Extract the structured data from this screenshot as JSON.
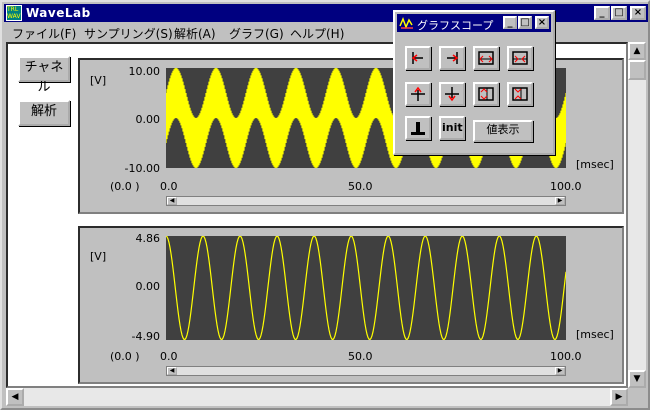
{
  "window": {
    "title": "WaveLab",
    "minimize": "_",
    "maximize": "□",
    "close": "×"
  },
  "menu": [
    {
      "label": "ファイル(F)"
    },
    {
      "label": "サンプリング(S)"
    },
    {
      "label": "解析(A)"
    },
    {
      "label": "グラフ(G)"
    },
    {
      "label": "ヘルプ(H)"
    }
  ],
  "side_buttons": {
    "channel": "チャネル",
    "analyze": "解析"
  },
  "scope_window": {
    "title": "グラフスコープ",
    "value_display": "値表示",
    "init": "init"
  },
  "chart_data": [
    {
      "type": "line",
      "ylabel": "[V]",
      "xlabel": "[msec]",
      "yticks": [
        "10.00",
        "0.00",
        "-10.00"
      ],
      "xticks": [
        "0.0",
        "50.0",
        "100.0"
      ],
      "x_origin_label": "(0.0     )",
      "ylim": [
        -10,
        10
      ],
      "xlim": [
        0,
        100
      ],
      "series": [
        {
          "color": "#ffff00",
          "cycles": 10,
          "amplitude_max": 10,
          "amplitude_min": -10,
          "dense": true
        }
      ]
    },
    {
      "type": "line",
      "ylabel": "[V]",
      "xlabel": "[msec]",
      "yticks": [
        "4.86",
        "0.00",
        "-4.90"
      ],
      "xticks": [
        "0.0",
        "50.0",
        "100.0"
      ],
      "x_origin_label": "(0.0     )",
      "ylim": [
        -4.9,
        4.86
      ],
      "xlim": [
        0,
        100
      ],
      "series": [
        {
          "color": "#ffff00",
          "cycles": 10.8,
          "amplitude": 4.86
        }
      ]
    }
  ]
}
